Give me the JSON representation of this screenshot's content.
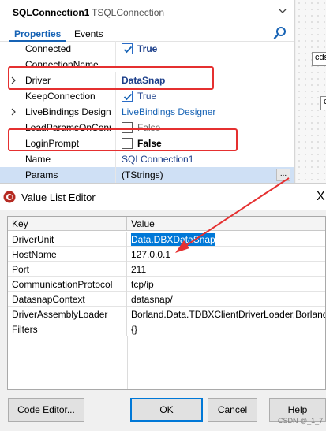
{
  "inspector": {
    "component_name": "SQLConnection1",
    "component_type": "TSQLConnection",
    "tabs": [
      {
        "label": "Properties"
      },
      {
        "label": "Events"
      }
    ],
    "properties": [
      {
        "name": "Connected",
        "value": "True",
        "checkbox": true,
        "checked": true
      },
      {
        "name": "ConnectionName",
        "value": ""
      },
      {
        "name": "Driver",
        "value": "DataSnap",
        "expandable": true
      },
      {
        "name": "KeepConnection",
        "value": "True",
        "checkbox": true,
        "checked": true
      },
      {
        "name": "LiveBindings Designe",
        "value": "LiveBindings Designer",
        "expandable": true
      },
      {
        "name": "LoadParamsOnConn",
        "value": "False",
        "checkbox": true,
        "checked": false
      },
      {
        "name": "LoginPrompt",
        "value": "False",
        "checkbox": true,
        "checked": false
      },
      {
        "name": "Name",
        "value": "SQLConnection1"
      },
      {
        "name": "Params",
        "value": "(TStrings)",
        "ellipsis": "..."
      }
    ]
  },
  "design_surface": {
    "components": [
      "cds",
      "c"
    ]
  },
  "dialog": {
    "title": "Value List Editor",
    "close_glyph": "X",
    "columns": {
      "key": "Key",
      "value": "Value"
    },
    "rows": [
      {
        "key": "DriverUnit",
        "value": "Data.DBXDataSnap",
        "selected": true
      },
      {
        "key": "HostName",
        "value": "127.0.0.1"
      },
      {
        "key": "Port",
        "value": "211"
      },
      {
        "key": "CommunicationProtocol",
        "value": "tcp/ip"
      },
      {
        "key": "DatasnapContext",
        "value": "datasnap/"
      },
      {
        "key": "DriverAssemblyLoader",
        "value": "Borland.Data.TDBXClientDriverLoader,Borland."
      },
      {
        "key": "Filters",
        "value": "{}"
      }
    ],
    "buttons": {
      "code_editor": "Code Editor...",
      "ok": "OK",
      "cancel": "Cancel",
      "help": "Help"
    }
  },
  "watermark": "CSDN @_1_7",
  "colors": {
    "highlight": "#e53030",
    "accent": "#1763b5",
    "selection": "#0078d7"
  }
}
